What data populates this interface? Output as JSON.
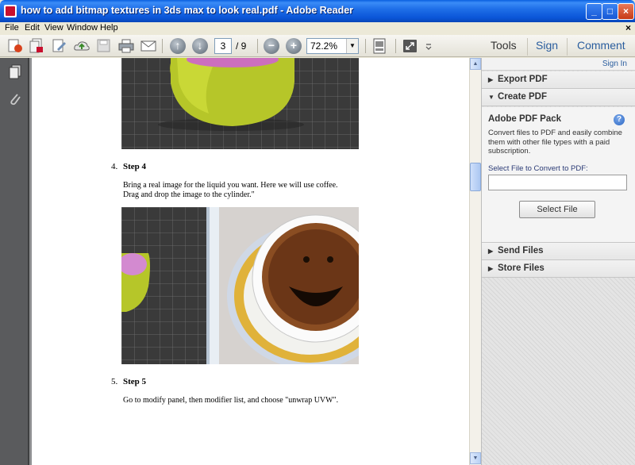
{
  "window": {
    "title": "how to add bitmap textures in 3ds max to look real.pdf - Adobe Reader",
    "buttons": {
      "minimize": "_",
      "maximize": "□",
      "close": "×"
    }
  },
  "menu": {
    "items": [
      "File",
      "Edit",
      "View",
      "Window",
      "Help"
    ],
    "close_glyph": "×"
  },
  "toolbar": {
    "page_current": "3",
    "page_total": "/ 9",
    "zoom": "72.2%",
    "tools_label": "Tools",
    "sign_label": "Sign",
    "comment_label": "Comment"
  },
  "document": {
    "step4": {
      "number": "4.",
      "title": "Step 4"
    },
    "step4_text": [
      "Bring a real image for the liquid you want. Here we will use coffee.",
      "Drag and drop the image to the cylinder.\""
    ],
    "step5": {
      "number": "5.",
      "title": "Step 5"
    },
    "step5_text": "Go to modify panel, then modifier list, and choose \"unwrap UVW\"."
  },
  "panel": {
    "sign_in": "Sign In",
    "export_pdf": "Export PDF",
    "create_pdf": "Create PDF",
    "pack_title": "Adobe PDF Pack",
    "pack_desc": "Convert files to PDF and easily combine them with other file types with a paid subscription.",
    "select_label": "Select File to Convert to PDF:",
    "select_button": "Select File",
    "send_files": "Send Files",
    "store_files": "Store Files"
  }
}
